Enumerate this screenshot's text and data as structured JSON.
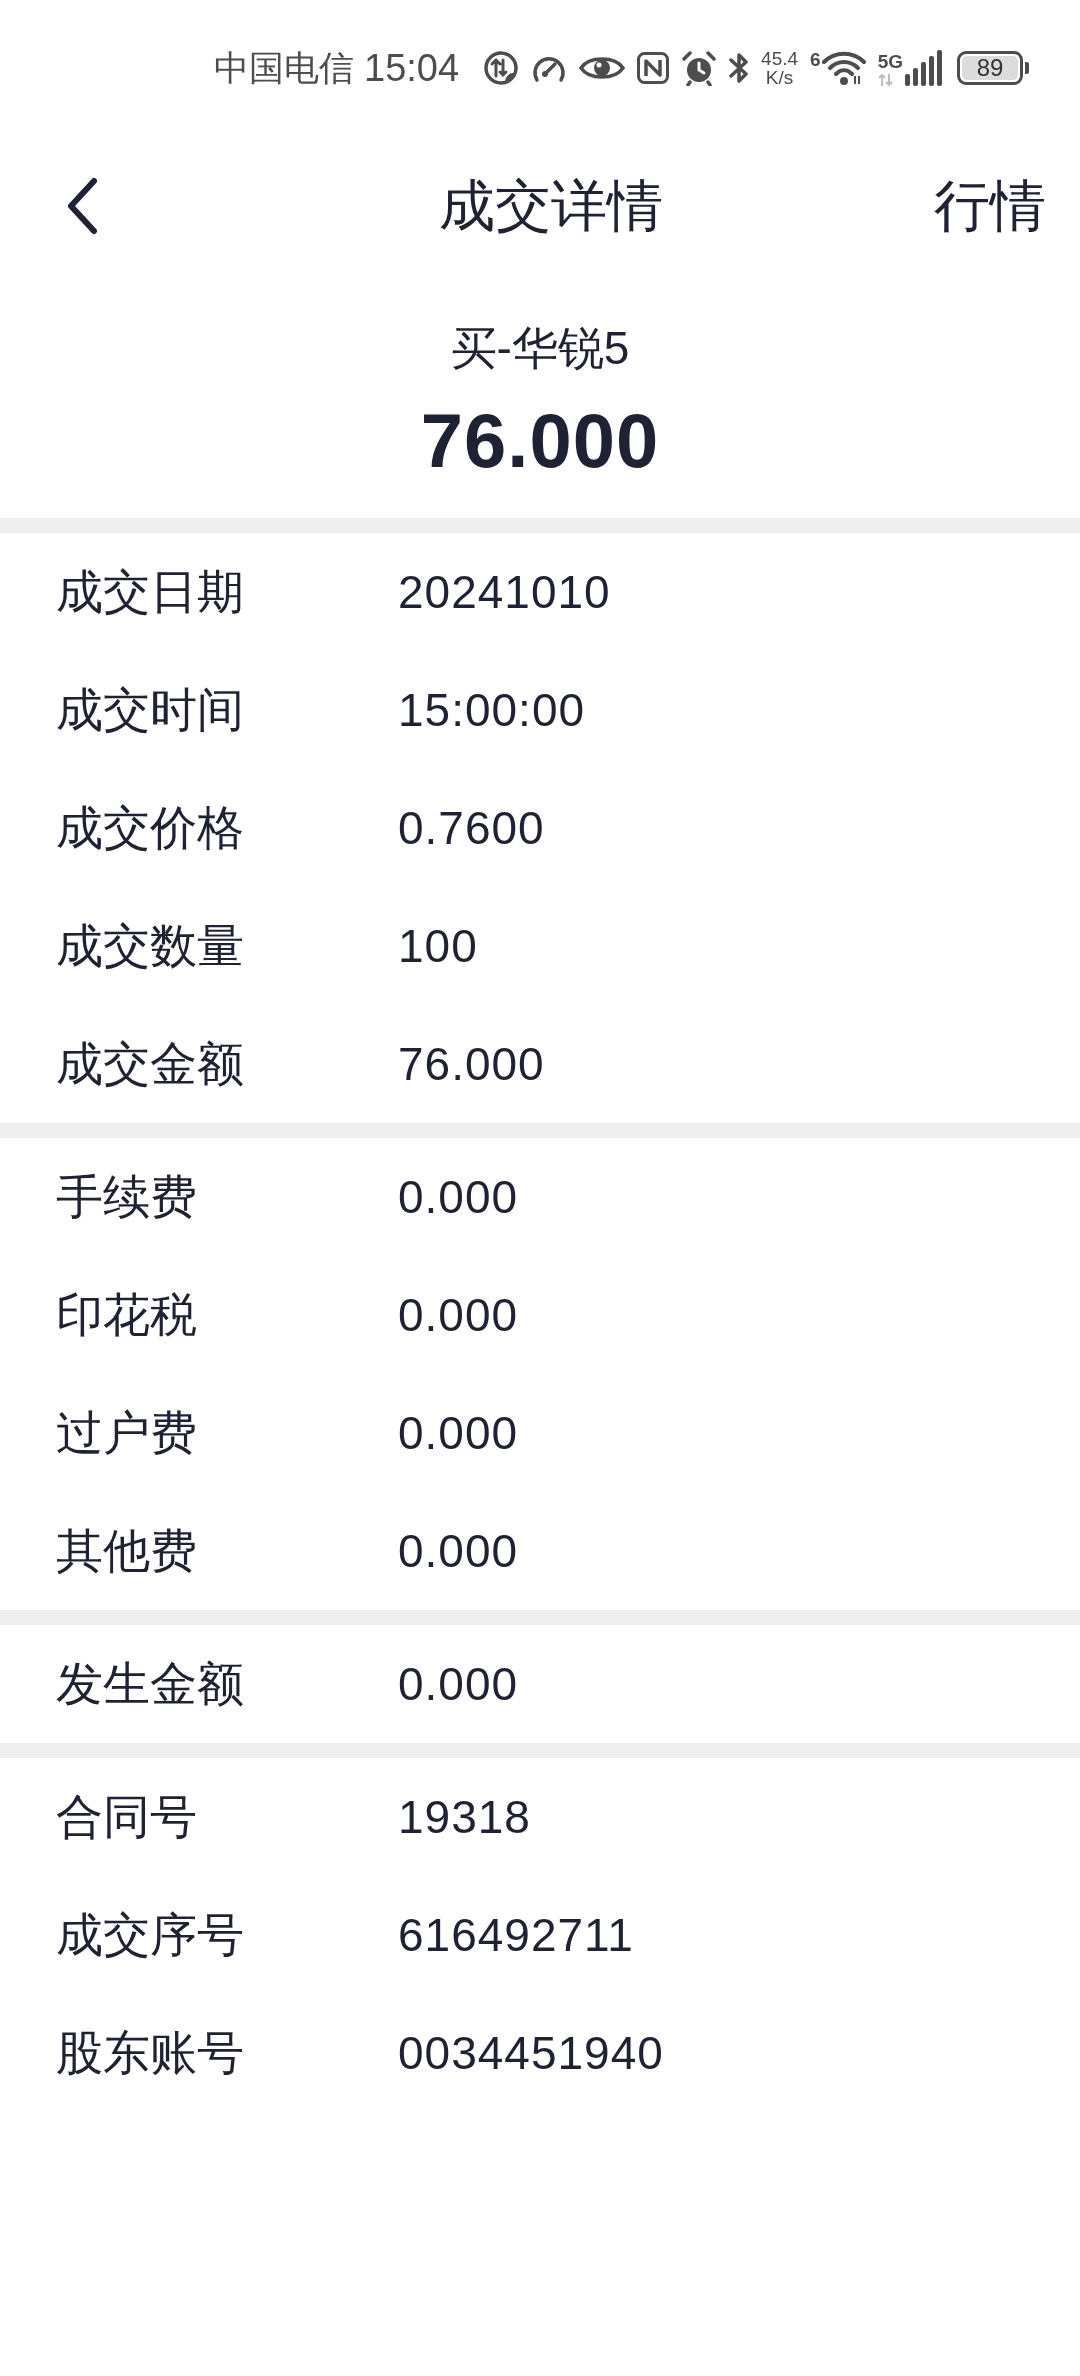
{
  "status_bar": {
    "carrier": "中国电信",
    "time": "15:04",
    "network_speed": {
      "value": "45.4",
      "unit": "K/s"
    },
    "wifi_label": "6",
    "network_type": "5G",
    "battery": "89"
  },
  "nav": {
    "title": "成交详情",
    "action": "行情"
  },
  "summary": {
    "name": "买-华锐5",
    "amount": "76.000"
  },
  "sections": [
    {
      "rows": [
        {
          "label": "成交日期",
          "value": "20241010"
        },
        {
          "label": "成交时间",
          "value": "15:00:00"
        },
        {
          "label": "成交价格",
          "value": "0.7600"
        },
        {
          "label": "成交数量",
          "value": "100"
        },
        {
          "label": "成交金额",
          "value": "76.000"
        }
      ]
    },
    {
      "rows": [
        {
          "label": "手续费",
          "value": "0.000"
        },
        {
          "label": "印花税",
          "value": "0.000"
        },
        {
          "label": "过户费",
          "value": "0.000"
        },
        {
          "label": "其他费",
          "value": "0.000"
        }
      ]
    },
    {
      "rows": [
        {
          "label": "发生金额",
          "value": "0.000"
        }
      ]
    },
    {
      "rows": [
        {
          "label": "合同号",
          "value": "19318"
        },
        {
          "label": "成交序号",
          "value": "616492711"
        },
        {
          "label": "股东账号",
          "value": "0034451940"
        }
      ]
    }
  ]
}
